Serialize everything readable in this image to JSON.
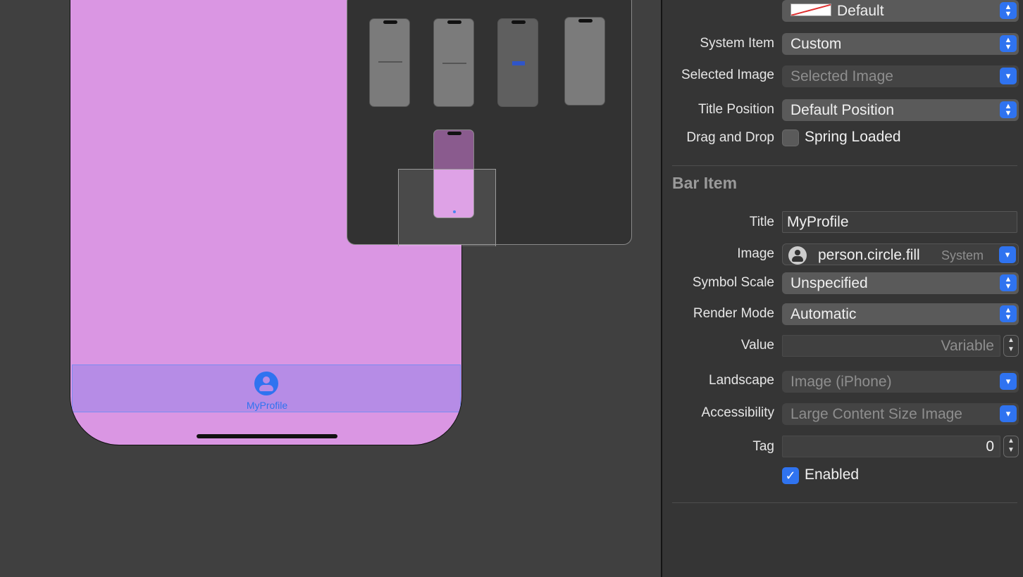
{
  "canvas": {
    "tab_item_label": "MyProfile",
    "tab_item_icon": "person-circle-fill-icon",
    "phone_background": "#da96e3"
  },
  "inspector": {
    "top_popup_value": "Default",
    "rows": {
      "system_item": {
        "label": "System Item",
        "value": "Custom"
      },
      "selected_image": {
        "label": "Selected Image",
        "placeholder": "Selected Image"
      },
      "title_position": {
        "label": "Title Position",
        "value": "Default Position"
      },
      "drag_and_drop": {
        "label": "Drag and Drop",
        "checkbox_label": "Spring Loaded",
        "checked": false
      }
    },
    "bar_item": {
      "section_title": "Bar Item",
      "title": {
        "label": "Title",
        "value": "MyProfile"
      },
      "image": {
        "label": "Image",
        "value": "person.circle.fill",
        "source": "System"
      },
      "symbol_scale": {
        "label": "Symbol Scale",
        "value": "Unspecified"
      },
      "render_mode": {
        "label": "Render Mode",
        "value": "Automatic"
      },
      "value": {
        "label": "Value",
        "placeholder": "Variable"
      },
      "landscape": {
        "label": "Landscape",
        "placeholder": "Image (iPhone)"
      },
      "accessibility": {
        "label": "Accessibility",
        "placeholder": "Large Content Size Image"
      },
      "tag": {
        "label": "Tag",
        "value": "0"
      },
      "enabled": {
        "label": "Enabled",
        "checked": true
      }
    },
    "accent_color": "#2f73f0"
  }
}
